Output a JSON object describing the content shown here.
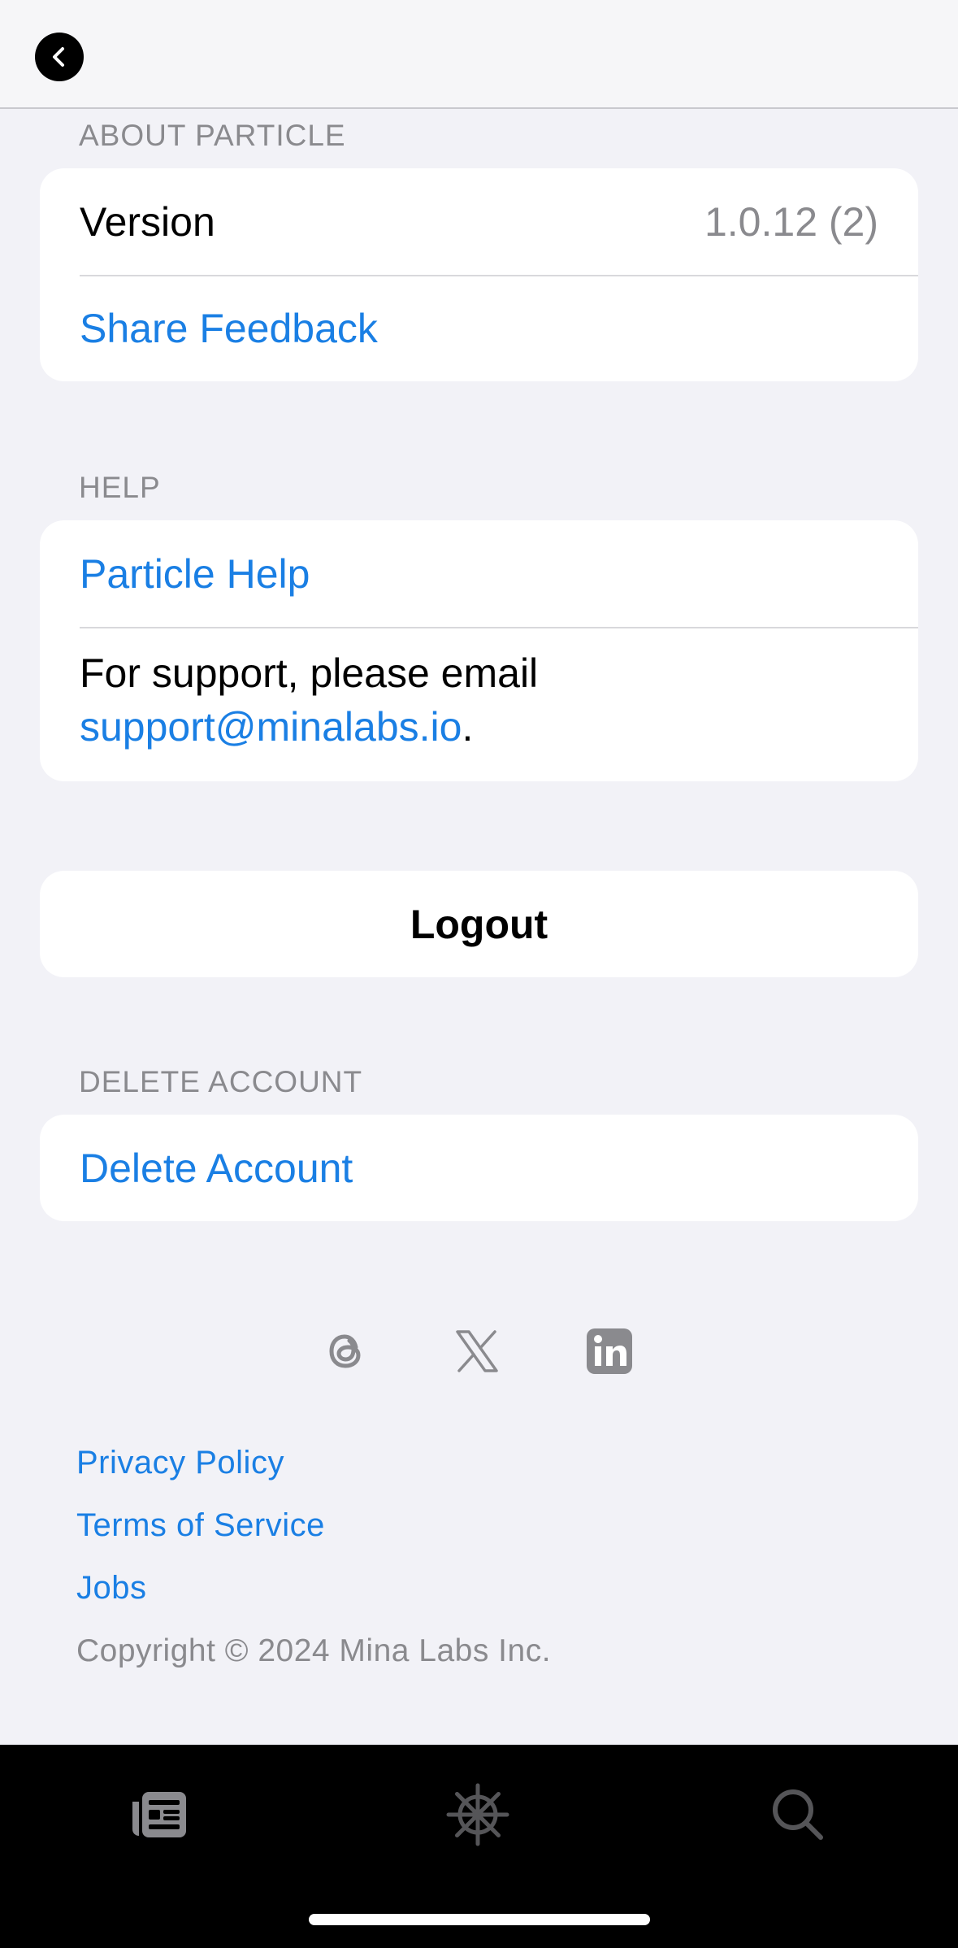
{
  "about": {
    "header": "ABOUT PARTICLE",
    "version_label": "Version",
    "version_value": "1.0.12 (2)",
    "share_feedback": "Share Feedback"
  },
  "help": {
    "header": "HELP",
    "particle_help": "Particle Help",
    "support_prefix": "For support, please email",
    "support_email": "support@minalabs.io",
    "support_suffix": "."
  },
  "logout": {
    "label": "Logout"
  },
  "delete": {
    "header": "DELETE ACCOUNT",
    "label": "Delete Account"
  },
  "social": {
    "icons": [
      "threads-icon",
      "x-icon",
      "linkedin-icon"
    ]
  },
  "footer": {
    "privacy": "Privacy Policy",
    "terms": "Terms of Service",
    "jobs": "Jobs",
    "copyright": "Copyright © 2024 Mina Labs Inc."
  },
  "tabbar": {
    "icons": [
      "newspaper-icon",
      "ship-wheel-icon",
      "search-icon"
    ]
  },
  "colors": {
    "link": "#1a7fe4",
    "secondary_text": "#8a8a8e",
    "background": "#f2f2f7",
    "tabbar_bg": "#000000"
  }
}
